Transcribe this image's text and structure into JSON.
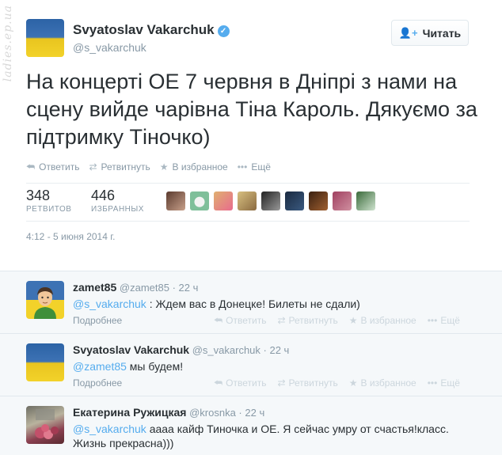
{
  "watermark": "ladies.ep.ua",
  "tweet": {
    "author_name": "Svyatoslav Vakarchuk",
    "verified_glyph": "✓",
    "handle": "@s_vakarchuk",
    "follow_label": "Читать",
    "text": "На концерті ОЕ 7 червня в Дніпрі з нами на сцену вийде чарівна Тіна Кароль. Дякуємо за підтримку Тіночко)",
    "actions": [
      "Ответить",
      "Ретвитнуть",
      "В избранное",
      "Ещё"
    ],
    "retweets": {
      "count": "348",
      "label": "РЕТВИТОВ"
    },
    "favorites": {
      "count": "446",
      "label": "ИЗБРАННЫХ"
    },
    "timestamp": "4:12 - 5 июня 2014 г."
  },
  "replies": [
    {
      "name": "zamet85",
      "handle": "@zamet85",
      "time": "22 ч",
      "mention": "@s_vakarchuk",
      "text": " : Ждем вас в Донецке! Билеты не сдали)",
      "more": "Подробнее"
    },
    {
      "name": "Svyatoslav Vakarchuk",
      "handle": "@s_vakarchuk",
      "time": "22 ч",
      "mention": "@zamet85",
      "text": " мы будем!",
      "more": "Подробнее"
    },
    {
      "name": "Екатерина Ружицкая",
      "handle": "@krosnka",
      "time": "22 ч",
      "mention": "@s_vakarchuk",
      "text": " аааа кайф Тиночка и ОЕ. Я сейчас умру от счастья!класс. Жизнь прекрасна)))",
      "more": ""
    }
  ],
  "reply_actions": [
    "Ответить",
    "Ретвитнуть",
    "В избранное",
    "Ещё"
  ],
  "colors": {
    "accent": "#55acee",
    "flag_blue": "#3d72b4",
    "flag_yellow": "#f2d22a"
  }
}
